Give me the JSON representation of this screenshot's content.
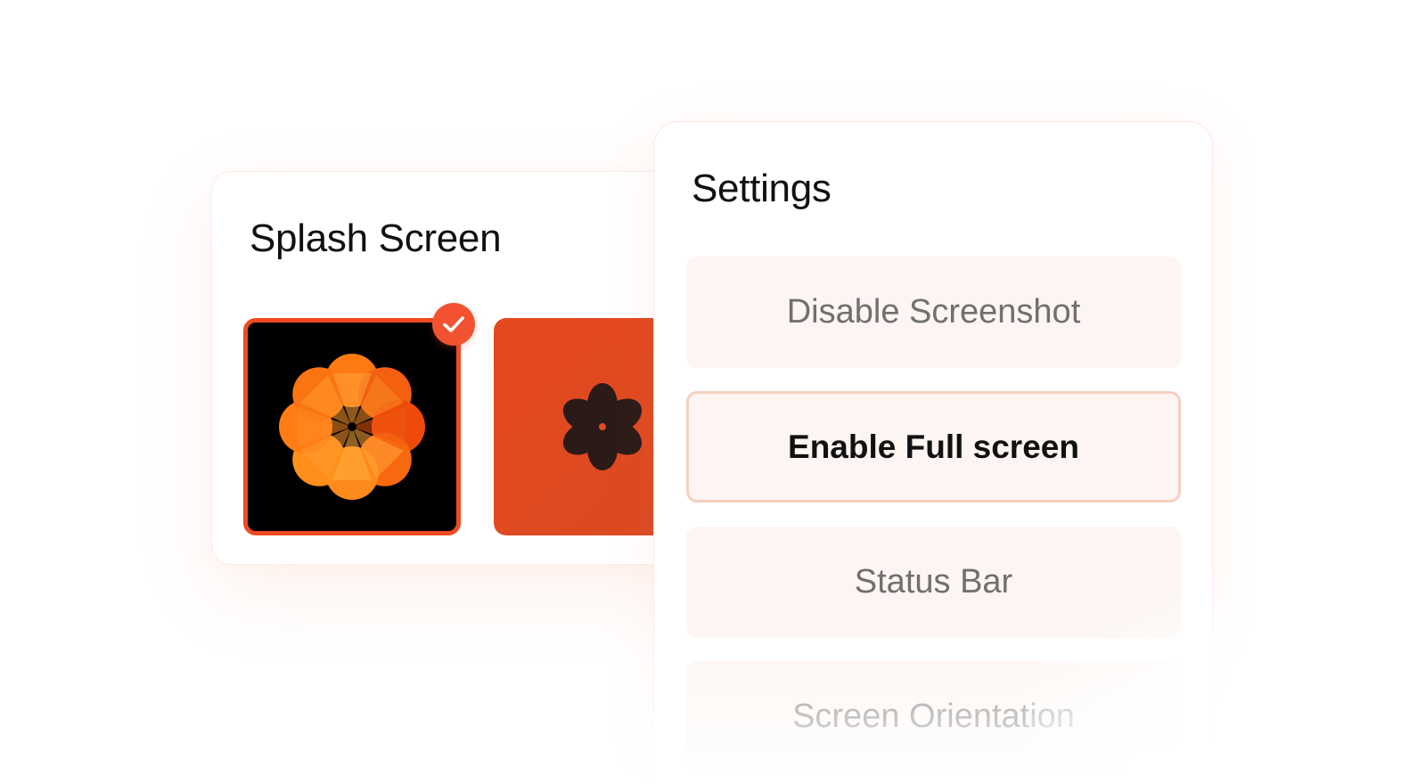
{
  "splash": {
    "title": "Splash Screen",
    "options": [
      {
        "name": "orange-flower-on-black",
        "selected": true
      },
      {
        "name": "dark-flower-on-orange",
        "selected": false
      }
    ]
  },
  "settings": {
    "title": "Settings",
    "items": [
      {
        "label": "Disable Screenshot",
        "active": false
      },
      {
        "label": "Enable Full screen",
        "active": true
      },
      {
        "label": "Status Bar",
        "active": false
      },
      {
        "label": "Screen Orientation",
        "active": false
      }
    ]
  },
  "colors": {
    "accent": "#f25230",
    "selected_border": "#ef4a22",
    "row_background": "#fdf5f1",
    "active_row_border": "#f6cfc1",
    "thumb_orange": "#e04a22"
  },
  "icons": {
    "check": "check-icon",
    "flower_orange": "orange-flower-icon",
    "flower_dark": "dark-flower-icon"
  }
}
